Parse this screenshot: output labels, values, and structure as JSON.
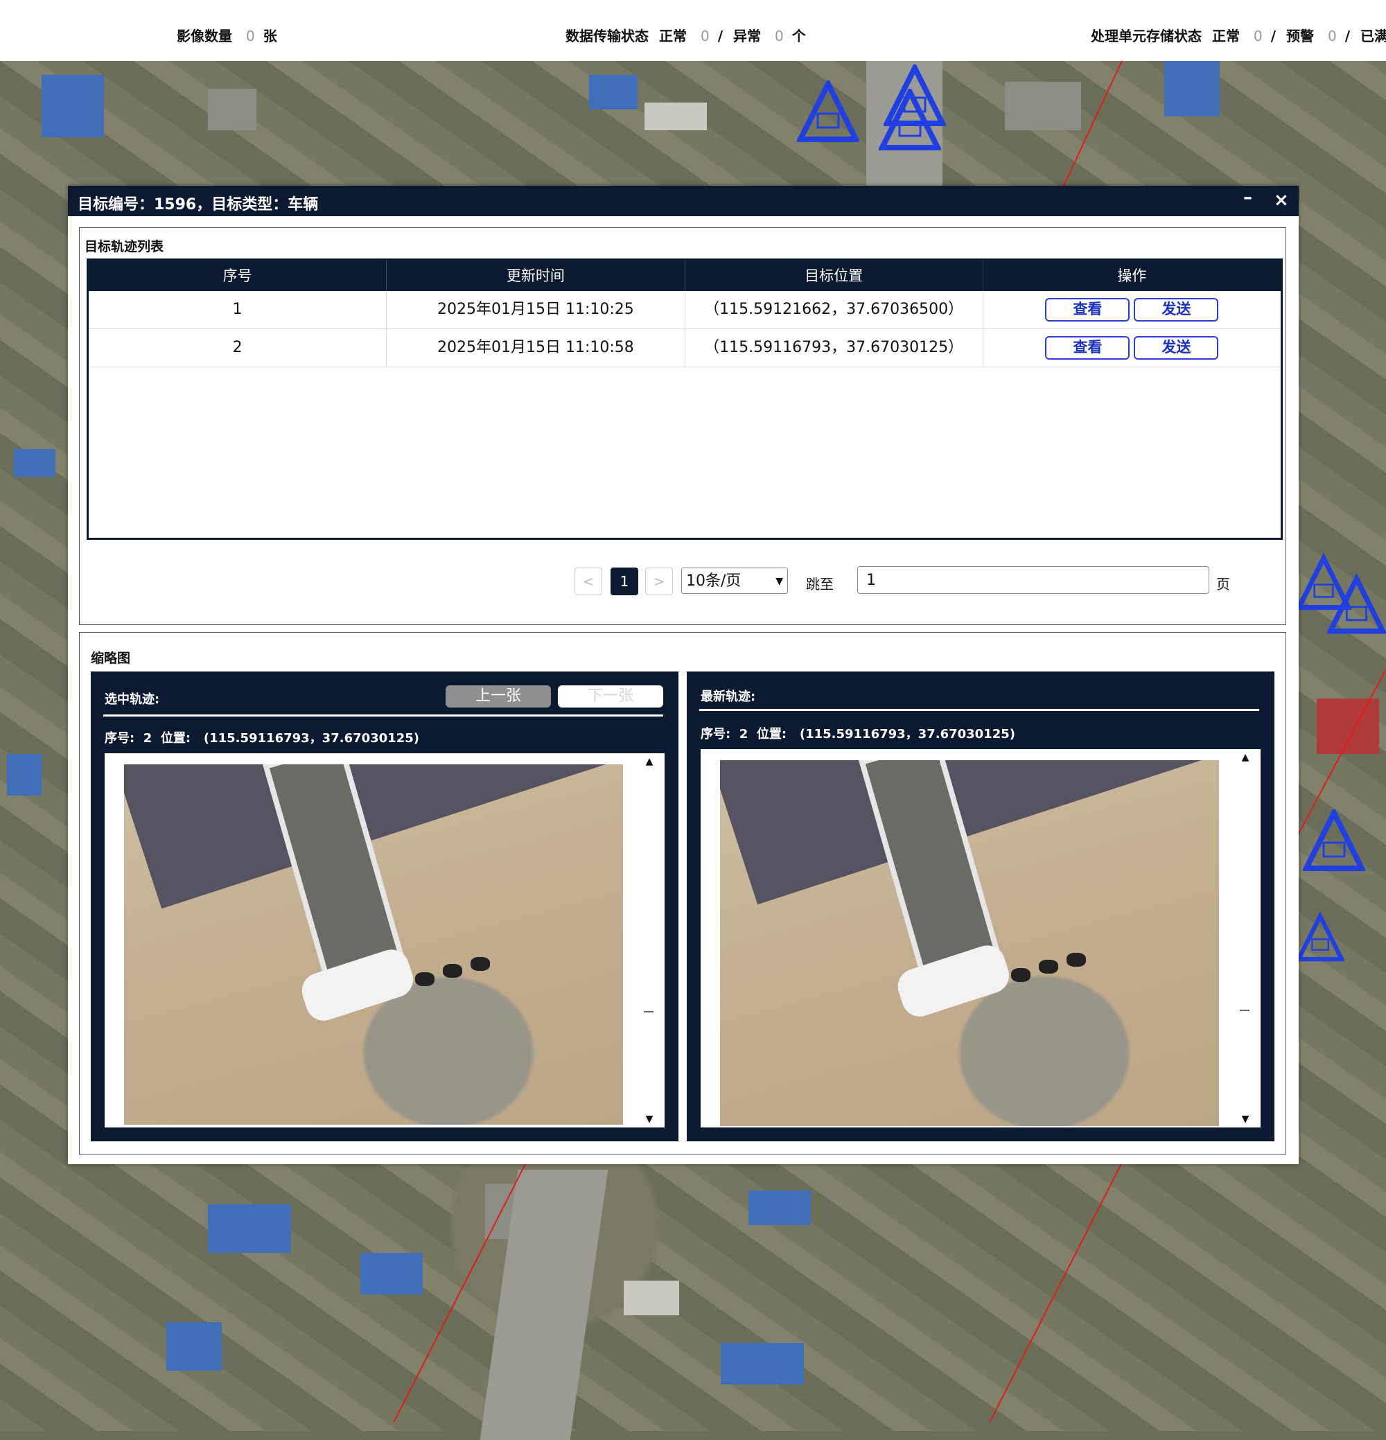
{
  "topbar": {
    "image_count_label": "影像数量",
    "image_count": "0",
    "image_count_unit": "张",
    "transfer_label": "数据传输状态",
    "transfer_normal_label": "正常",
    "transfer_normal": "0",
    "transfer_abnormal_label": "异常",
    "transfer_abnormal": "0",
    "transfer_unit": "个",
    "storage_label": "处理单元存储状态",
    "storage_normal_label": "正常",
    "storage_normal": "0",
    "storage_warning_label": "预警",
    "storage_warning": "0",
    "storage_full_label": "已满",
    "separator": "/"
  },
  "dialog": {
    "title": "目标编号：1596，目标类型：车辆",
    "minimize_icon": "minimize-icon",
    "close_icon": "close-icon",
    "minimize_glyph": "–",
    "close_glyph": "×"
  },
  "track_list": {
    "section_title": "目标轨迹列表",
    "columns": [
      "序号",
      "更新时间",
      "目标位置",
      "操作"
    ],
    "rows": [
      {
        "index": "1",
        "time": "2025年01月15日 11:10:25",
        "position": "（115.59121662，37.67036500）",
        "view": "查看",
        "send": "发送"
      },
      {
        "index": "2",
        "time": "2025年01月15日 11:10:58",
        "position": "（115.59116793，37.67030125）",
        "view": "查看",
        "send": "发送"
      }
    ]
  },
  "pagination": {
    "prev": "<",
    "current_page": "1",
    "next": ">",
    "page_size": "10条/页",
    "jump_label": "跳至",
    "jump_value": "1",
    "page_unit": "页"
  },
  "thumbnails": {
    "section_title": "缩略图",
    "selected": {
      "title": "选中轨迹:",
      "prev_button": "上一张",
      "next_button": "下一张",
      "index_label": "序号:",
      "index": "2",
      "position_label": "位置:",
      "position": "(115.59116793，37.67030125)"
    },
    "latest": {
      "title": "最新轨迹:",
      "index_label": "序号:",
      "index": "2",
      "position_label": "位置:",
      "position": "(115.59116793，37.67030125)"
    }
  },
  "colors": {
    "dark_navy": "#0b1a31",
    "button_blue": "#2b3fd6",
    "map_marker_blue": "#1f3fe0",
    "route_red": "#e01b1b"
  }
}
